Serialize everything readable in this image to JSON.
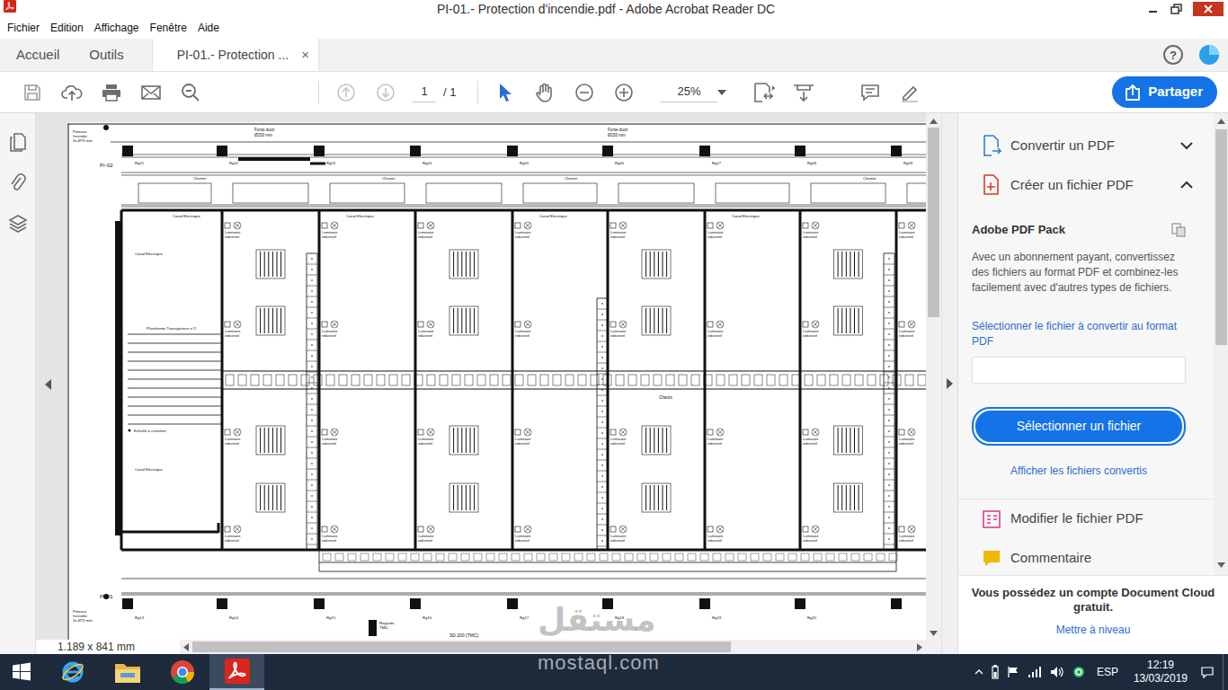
{
  "window": {
    "title": "PI-01.- Protection d'incendie.pdf - Adobe Acrobat Reader DC"
  },
  "menu": [
    "Fichier",
    "Edition",
    "Affichage",
    "Fenêtre",
    "Aide"
  ],
  "tabs": [
    {
      "label": "Accueil",
      "selected": false
    },
    {
      "label": "Outils",
      "selected": false
    },
    {
      "label": "PI-01.- Protection ...",
      "selected": true,
      "close": "×"
    }
  ],
  "help": "?",
  "toolbar": {
    "nav": [
      {
        "kind": "prev",
        "disabled": true
      },
      {
        "kind": "next",
        "disabled": true
      }
    ],
    "page": "1",
    "page_total": "/ 1",
    "tools": [
      {
        "kind": "select",
        "selected": true
      },
      {
        "kind": "hand",
        "selected": false
      }
    ],
    "zoom": "25%",
    "share": "Partager"
  },
  "tools_pane": {
    "sections": [
      {
        "label": "Convertir un PDF",
        "expanded": false
      },
      {
        "label": "Créer un fichier PDF",
        "expanded": true
      }
    ],
    "pack": {
      "title": "Adobe PDF Pack",
      "text": "Avec un abonnement payant, convertissez des fichiers au format PDF et combinez-les facilement avec d'autres types de fichiers.",
      "link": "Sélectionner le fichier à convertir au format PDF",
      "button": "Sélectionner un fichier",
      "converted": "Afficher les fichiers convertis"
    },
    "more": [
      "Modifier le fichier PDF",
      "Commentaire"
    ],
    "scroll_level": 0.48,
    "footer": {
      "text": "Vous possédez un compte Document Cloud gratuit.",
      "link": "Mettre à niveau"
    }
  },
  "document": {
    "page_size": "1.189 x 841 mm",
    "scroll": {
      "vertical_level": 0.37,
      "horizontal_level": 0.74
    },
    "drawing": {
      "hydrant": [
        "Poteaux",
        "Incendie",
        "3x Ø75 mm"
      ],
      "pipe": [
        "Fonte ducti",
        "Ø150 mm"
      ],
      "sections": [
        "Pr-02",
        "Pr-01"
      ],
      "grid_top": [
        "Rg01",
        "Rg02",
        "Rg03",
        "Rg04",
        "Rg05",
        "Rg06",
        "Rg07",
        "Rg08",
        "Rg09"
      ],
      "grid_bottom": [
        "Rg13",
        "Rg14",
        "Rg15",
        "Rg16",
        "Rg17",
        "Rg18",
        "Rg19",
        "Rg20"
      ],
      "band": "Chemin",
      "canal": "Canal Electrique",
      "luminaire": [
        "Luminaire",
        "industriel"
      ],
      "platform": "Plateforme Transporteur n°2",
      "ladder": "Echelle a crinoline",
      "chariot": "Chariot",
      "regards": [
        "Regards",
        "TMU"
      ],
      "pipe_bottom": "SD 200 (TMC)"
    }
  },
  "taskbar": {
    "apps": [
      {
        "kind": "ie",
        "active": false
      },
      {
        "kind": "explorer",
        "active": false
      },
      {
        "kind": "chrome",
        "active": false
      },
      {
        "kind": "acrobat",
        "active": true
      }
    ],
    "language": "ESP",
    "time": "12:19",
    "date": "13/03/2019"
  },
  "watermark": {
    "logo": "مستقل",
    "site": "mostaql.com"
  }
}
